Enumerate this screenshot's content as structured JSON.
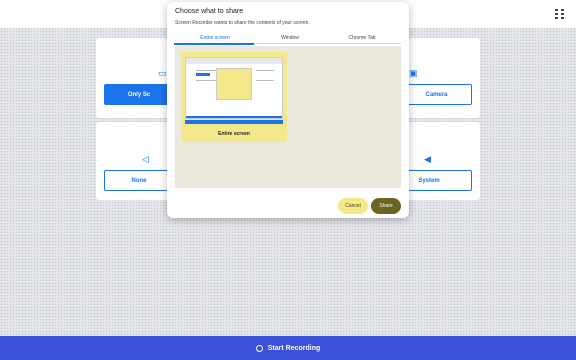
{
  "dialog": {
    "title": "Choose what to share",
    "subtitle": "Screen Recorder wants to share the contents of your screen.",
    "tabs": [
      "Entire screen",
      "Window",
      "Chrome Tab"
    ],
    "active_tab": "Entire screen",
    "thumbnail_label": "Entire screen",
    "cancel_label": "Cancel",
    "share_label": "Share"
  },
  "video_options": [
    {
      "label": "Only Sc",
      "icon": "monitor-icon",
      "selected": true
    },
    {
      "label": "Camera",
      "icon": "camera-icon",
      "selected": false
    }
  ],
  "audio_options": [
    {
      "label": "None",
      "icon": "speaker-mute-icon",
      "selected": false
    },
    {
      "label": "System",
      "icon": "speaker-icon",
      "selected": false
    }
  ],
  "bottom_bar": {
    "label": "Start Recording",
    "icon": "record-icon"
  },
  "colors": {
    "accent": "#1a73e8",
    "bottom_bar": "#3b50d8",
    "thumbnail": "#f4e98a",
    "share_button": "#6b6520"
  }
}
